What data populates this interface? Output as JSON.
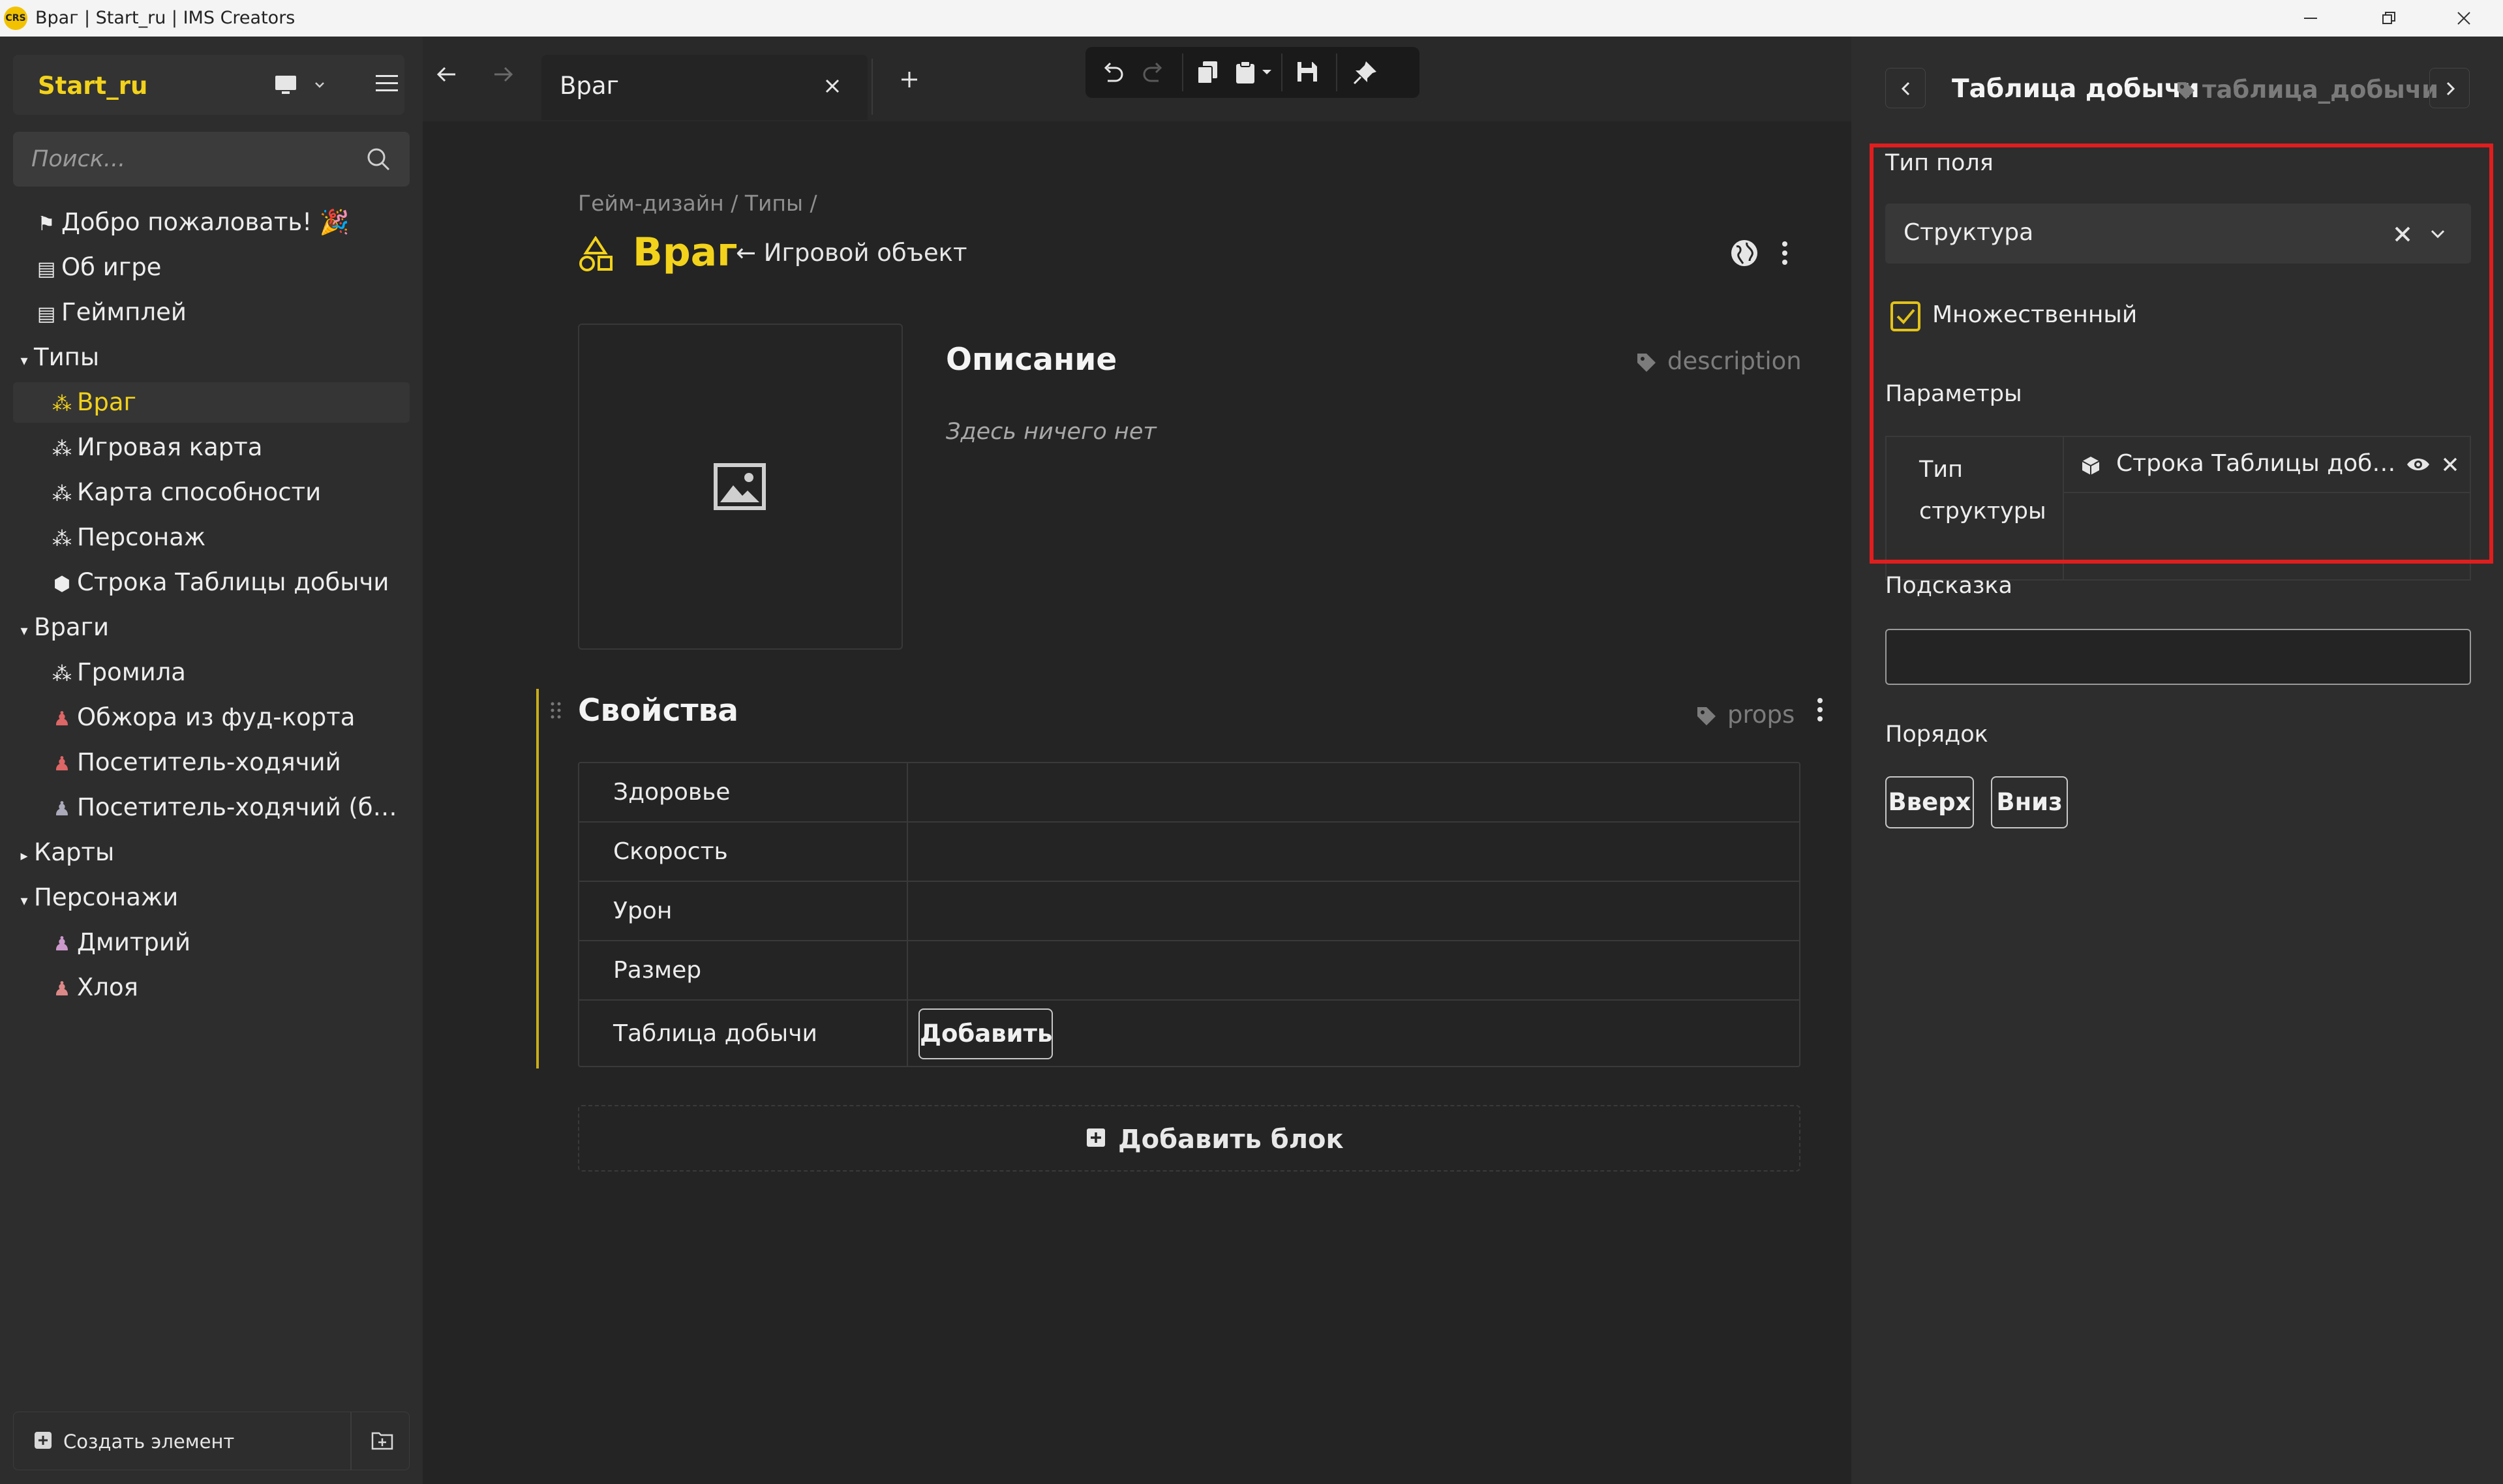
{
  "window": {
    "title": "Враг | Start_ru | IMS Creators",
    "logo_text": "CRS"
  },
  "sidebar": {
    "project_name": "Start_ru",
    "search_placeholder": "Поиск...",
    "tree": [
      {
        "label": "Добро пожаловать! 🎉",
        "icon": "flag-icon"
      },
      {
        "label": "Об игре",
        "icon": "document-icon"
      },
      {
        "label": "Геймплей",
        "icon": "document-icon"
      },
      {
        "label": "Типы",
        "icon": "caret-down-icon"
      },
      {
        "label": "Враг",
        "icon": "shapes-icon",
        "active": true
      },
      {
        "label": "Игровая карта",
        "icon": "shapes-icon"
      },
      {
        "label": "Карта способности",
        "icon": "shapes-icon"
      },
      {
        "label": "Персонаж",
        "icon": "shapes-icon"
      },
      {
        "label": "Строка Таблицы добычи",
        "icon": "cube-icon"
      },
      {
        "label": "Враги",
        "icon": "caret-down-icon"
      },
      {
        "label": "Громила",
        "icon": "shapes-icon"
      },
      {
        "label": "Обжора из фуд-корта",
        "icon": "character-icon"
      },
      {
        "label": "Посетитель-ходячий",
        "icon": "character-icon"
      },
      {
        "label": "Посетитель-ходячий (бро…",
        "icon": "character-icon"
      },
      {
        "label": "Карты",
        "icon": "caret-right-icon"
      },
      {
        "label": "Персонажи",
        "icon": "caret-down-icon"
      },
      {
        "label": "Дмитрий",
        "icon": "character-icon"
      },
      {
        "label": "Хлоя",
        "icon": "character-icon"
      }
    ],
    "create_label": "Создать элемент"
  },
  "tabs": [
    {
      "label": "Враг",
      "active": true
    }
  ],
  "main": {
    "breadcrumb": "Гейм-дизайн / Типы /",
    "title": "Враг",
    "parent": "← Игровой объект",
    "description": {
      "title": "Описание",
      "key": "description",
      "empty_text": "Здесь ничего нет"
    },
    "properties": {
      "title": "Свойства",
      "key": "props",
      "rows": [
        "Здоровье",
        "Скорость",
        "Урон",
        "Размер",
        "Таблица добычи"
      ],
      "add_button": "Добавить"
    },
    "add_block": "Добавить блок"
  },
  "right_panel": {
    "title": "Таблица добычи",
    "key": "таблица_добычи",
    "field_type_label": "Тип поля",
    "field_type_value": "Структура",
    "multiple_label": "Множественный",
    "multiple_checked": true,
    "params_label": "Параметры",
    "param_name_line1": "Тип",
    "param_name_line2": "структуры",
    "param_value": "Строка Таблицы доб…",
    "hint_label": "Подсказка",
    "hint_value": "",
    "order_label": "Порядок",
    "up_button": "Вверх",
    "down_button": "Вниз"
  },
  "colors": {
    "accent": "#f2d21b",
    "highlight_box": "#e01e1e",
    "bg_main": "#242424",
    "bg_panel": "#2d2d2d"
  }
}
